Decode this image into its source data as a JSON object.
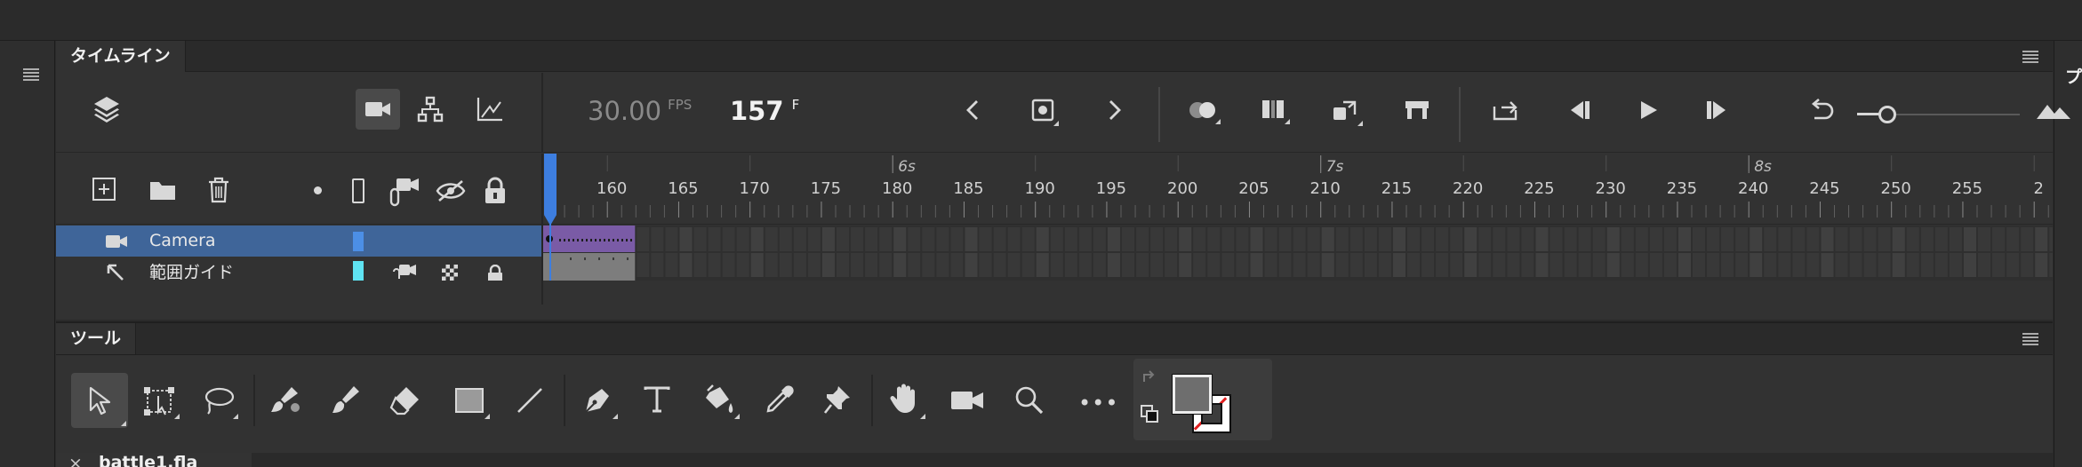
{
  "right_edge_glyph": "プ",
  "timeline": {
    "tab_label": "タイムライン",
    "fps_value": "30.00",
    "fps_unit": "FPS",
    "frame_value": "157",
    "frame_unit": "F",
    "ruler": {
      "time_labels": [
        "6s",
        "7s",
        "8s"
      ],
      "frame_labels": [
        "160",
        "165",
        "170",
        "175",
        "180",
        "185",
        "190",
        "195",
        "200",
        "205",
        "210",
        "215",
        "220",
        "225",
        "230",
        "235",
        "240",
        "245",
        "250",
        "255",
        "2"
      ]
    },
    "layers": [
      {
        "name": "Camera",
        "icon": "camera-icon",
        "swatch": "#4c8fe6",
        "selected": true
      },
      {
        "name": "範囲ガイド",
        "icon": "guide-layer-icon",
        "swatch": "#5fe3f2",
        "selected": false
      }
    ],
    "colors": {
      "selected_row": "#3f6599",
      "camera_frames": "#7a5ba6",
      "guide_frames": "#7d7d7d",
      "playhead": "#3d7ee0"
    }
  },
  "tools": {
    "tab_label": "ツール",
    "more_label": "•••"
  },
  "document_tab": {
    "close_glyph": "×",
    "title": "battle1.fla"
  }
}
